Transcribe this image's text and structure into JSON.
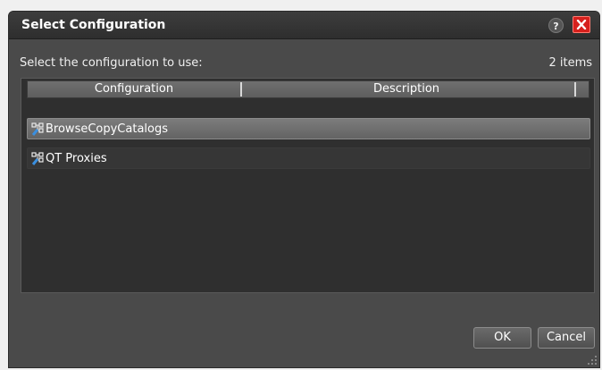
{
  "dialog": {
    "title": "Select Configuration",
    "help_label": "?",
    "prompt": "Select the configuration to use:",
    "item_count": "2 items"
  },
  "table": {
    "columns": [
      "Configuration",
      "Description"
    ],
    "rows": [
      {
        "name": "BrowseCopyCatalogs",
        "description": "",
        "selected": true
      },
      {
        "name": "QT Proxies",
        "description": "",
        "selected": false
      }
    ]
  },
  "buttons": {
    "ok": "OK",
    "cancel": "Cancel"
  },
  "icons": {
    "help": "help-icon",
    "close": "close-icon",
    "row": "configuration-icon",
    "resize": "resize-grip-icon"
  },
  "colors": {
    "close": "#d6201d",
    "selected_row": "#6f6f6f",
    "dialog_bg": "#4a4a4a"
  }
}
